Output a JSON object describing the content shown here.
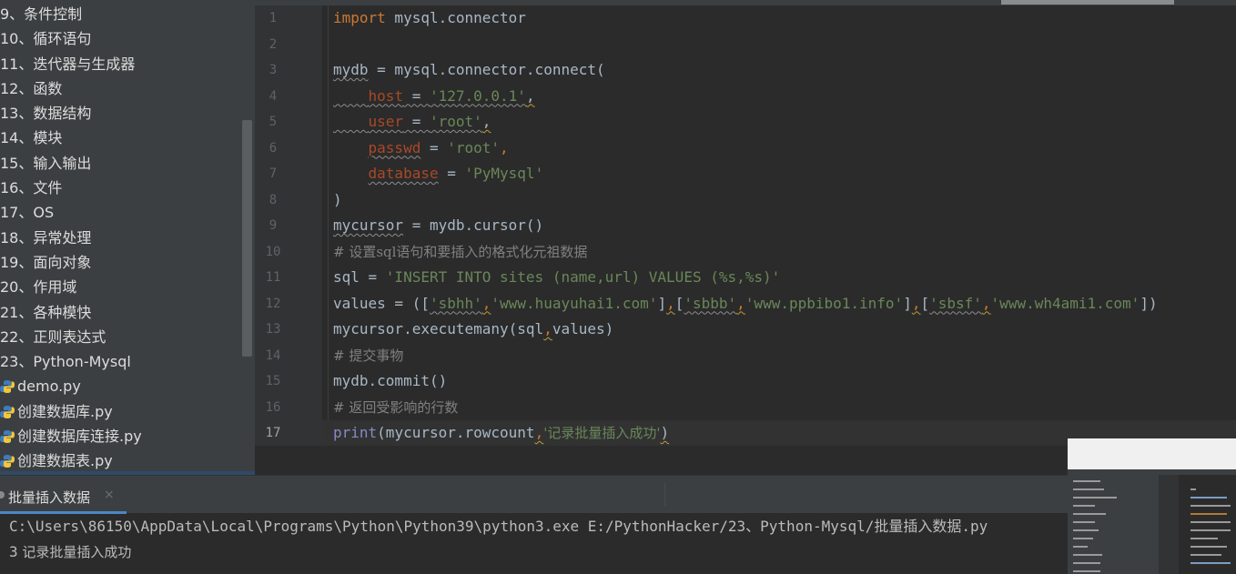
{
  "sidebar": {
    "items": [
      {
        "label": "9、条件控制",
        "type": "folder"
      },
      {
        "label": "10、循环语句",
        "type": "folder"
      },
      {
        "label": "11、迭代器与生成器",
        "type": "folder"
      },
      {
        "label": "12、函数",
        "type": "folder"
      },
      {
        "label": "13、数据结构",
        "type": "folder"
      },
      {
        "label": "14、模块",
        "type": "folder"
      },
      {
        "label": "15、输入输出",
        "type": "folder"
      },
      {
        "label": "16、文件",
        "type": "folder"
      },
      {
        "label": "17、OS",
        "type": "folder"
      },
      {
        "label": "18、异常处理",
        "type": "folder"
      },
      {
        "label": "19、面向对象",
        "type": "folder"
      },
      {
        "label": "20、作用域",
        "type": "folder"
      },
      {
        "label": "21、各种模快",
        "type": "folder"
      },
      {
        "label": "22、正则表达式",
        "type": "folder"
      },
      {
        "label": "23、Python-Mysql",
        "type": "folder"
      },
      {
        "label": "demo.py",
        "type": "python-file"
      },
      {
        "label": "创建数据库.py",
        "type": "python-file"
      },
      {
        "label": "创建数据库连接.py",
        "type": "python-file"
      },
      {
        "label": "创建数据表.py",
        "type": "python-file"
      }
    ],
    "file_icon": "python-file-icon"
  },
  "editor": {
    "current_line": 17,
    "line_numbers": [
      "1",
      "2",
      "3",
      "4",
      "5",
      "6",
      "7",
      "8",
      "9",
      "10",
      "11",
      "12",
      "13",
      "14",
      "15",
      "16",
      "17"
    ],
    "code": {
      "l1_kw": "import",
      "l1_rest": " mysql.connector",
      "l3_var": "mydb",
      "l3_rest": " = mysql.connector.connect(",
      "l4_indent": "    ",
      "l4_param": "host",
      "l4_eq": " = ",
      "l4_str": "'127.0.0.1'",
      "l4_comma": ",",
      "l5_param": "user",
      "l5_eq": " = ",
      "l5_str": "'root'",
      "l5_comma": ",",
      "l6_param": "passwd",
      "l6_eq": " = ",
      "l6_str": "'root'",
      "l6_comma": ",",
      "l7_param": "database",
      "l7_eq": " = ",
      "l7_str": "'PyMysql'",
      "l8": ")",
      "l9_var": "mycursor",
      "l9_rest": " = mydb.cursor()",
      "l10_comment": "# 设置sql语句和要插入的格式化元祖数据",
      "l11_pre": "sql = ",
      "l11_str": "'INSERT INTO sites (name,url) VALUES (%s,%s)'",
      "l12_pre": "values = ([",
      "l12_s1": "'sbhh'",
      "l12_s2": "'www.huayuhai1.com'",
      "l12_s3": "'sbbb'",
      "l12_s4": "'www.ppbibo1.info'",
      "l12_s5": "'sbsf'",
      "l12_s6": "'www.wh4ami1.com'",
      "l12_end": "])",
      "l13": "mycursor.executemany(sql",
      "l13_end": "values)",
      "l14_comment": "# 提交事物",
      "l15": "mydb.commit()",
      "l16_comment": "# 返回受影响的行数",
      "l17_fn": "print",
      "l17_mid": "(mycursor.rowcount",
      "l17_str": "'记录批量插入成功'",
      "l17_end": ")"
    }
  },
  "run": {
    "tab_label": "批量插入数据",
    "close_glyph": "×",
    "command": "C:\\Users\\86150\\AppData\\Local\\Programs\\Python\\Python39\\python3.exe E:/PythonHacker/23、Python-Mysql/批量插入数据.py",
    "output_count": "3",
    "output_text": " 记录批量插入成功"
  },
  "colors": {
    "keyword": "#cc7832",
    "string": "#6a8759",
    "parameter": "#aa4926",
    "comment": "#808080",
    "builtin": "#8888c6",
    "tab_accent": "#4a88c7"
  }
}
